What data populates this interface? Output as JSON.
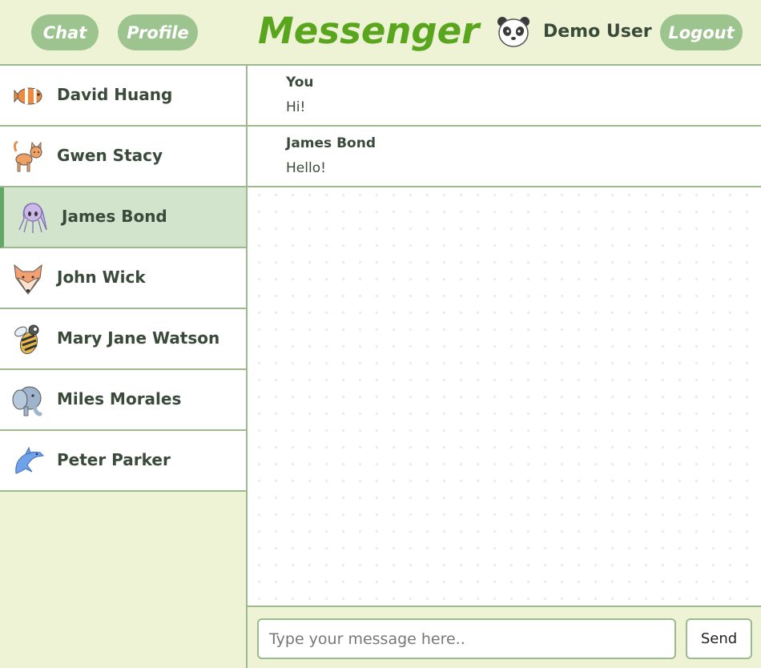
{
  "header": {
    "chat_label": "Chat",
    "profile_label": "Profile",
    "title": "Messenger",
    "user_name": "Demo User",
    "user_icon": "panda-icon",
    "logout_label": "Logout"
  },
  "sidebar": {
    "contacts": [
      {
        "name": "David Huang",
        "icon": "clownfish-icon",
        "active": false
      },
      {
        "name": "Gwen Stacy",
        "icon": "cat-icon",
        "active": false
      },
      {
        "name": "James Bond",
        "icon": "octopus-icon",
        "active": true
      },
      {
        "name": "John Wick",
        "icon": "fox-icon",
        "active": false
      },
      {
        "name": "Mary Jane Watson",
        "icon": "bee-icon",
        "active": false
      },
      {
        "name": "Miles Morales",
        "icon": "elephant-icon",
        "active": false
      },
      {
        "name": "Peter Parker",
        "icon": "dolphin-icon",
        "active": false
      }
    ]
  },
  "chat": {
    "messages": [
      {
        "sender": "You",
        "text": "Hi!"
      },
      {
        "sender": "James Bond",
        "text": "Hello!"
      }
    ],
    "input_placeholder": "Type your message here..",
    "input_value": "",
    "send_label": "Send"
  },
  "colors": {
    "accent_green": "#5aa51e",
    "pill_green": "#9dc38f",
    "background": "#eef3d6",
    "active_row": "#d2e4cc",
    "border": "#9cba8e"
  }
}
